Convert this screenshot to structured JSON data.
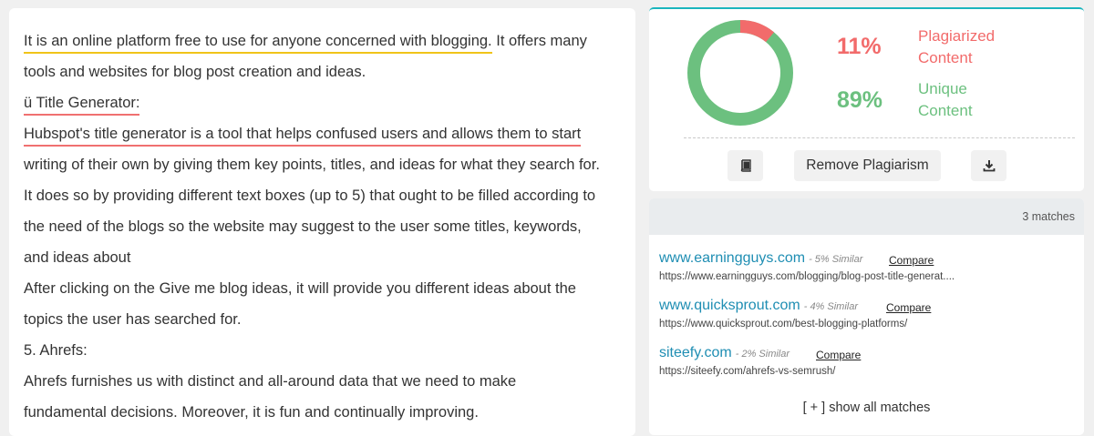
{
  "text": {
    "lines": [
      [
        "It is an online platform free to use for anyone concerned with blogging.",
        " It offers many"
      ],
      "tools and websites for blog post creation and ideas.",
      "ü Title Generator:",
      "Hubspot's title generator is a tool that helps confused users and allows them to start",
      "writing of their own by giving them key points, titles, and ideas for what they search for.",
      "It does so by providing different text boxes (up to 5) that ought to be filled according to",
      "the need of the blogs so the website may suggest to the user some titles, keywords,",
      "and ideas about",
      "After clicking on the Give me blog ideas, it will provide you different ideas about the",
      "topics the user has searched for.",
      "5. Ahrefs:",
      "Ahrefs furnishes us with distinct and all-around data that we need to make",
      "fundamental decisions. Moreover, it is fun and continually improving."
    ]
  },
  "stats": {
    "plagiarized_percent": 11,
    "unique_percent": 89,
    "plagiarized_pct_text": "11%",
    "unique_pct_text": "89%",
    "plagiarized_label_1": "Plagiarized",
    "plagiarized_label_2": "Content",
    "unique_label_1": "Unique",
    "unique_label_2": "Content",
    "colors": {
      "plagiarized": "#f26b6b",
      "unique": "#6cc07f",
      "accent": "#19b5bd"
    }
  },
  "actions": {
    "book_icon": "book-icon",
    "remove_label": "Remove Plagiarism",
    "download_icon": "download-icon"
  },
  "matches": {
    "count_text": "3 matches",
    "items": [
      {
        "domain": "www.earningguys.com",
        "similar": "- 5% Similar",
        "compare": "Compare",
        "url": "https://www.earningguys.com/blogging/blog-post-title-generat...."
      },
      {
        "domain": "www.quicksprout.com",
        "similar": "- 4% Similar",
        "compare": "Compare",
        "url": "https://www.quicksprout.com/best-blogging-platforms/"
      },
      {
        "domain": "siteefy.com",
        "similar": "- 2% Similar",
        "compare": "Compare",
        "url": "https://siteefy.com/ahrefs-vs-semrush/"
      }
    ],
    "show_all": "[ + ] show all matches"
  }
}
